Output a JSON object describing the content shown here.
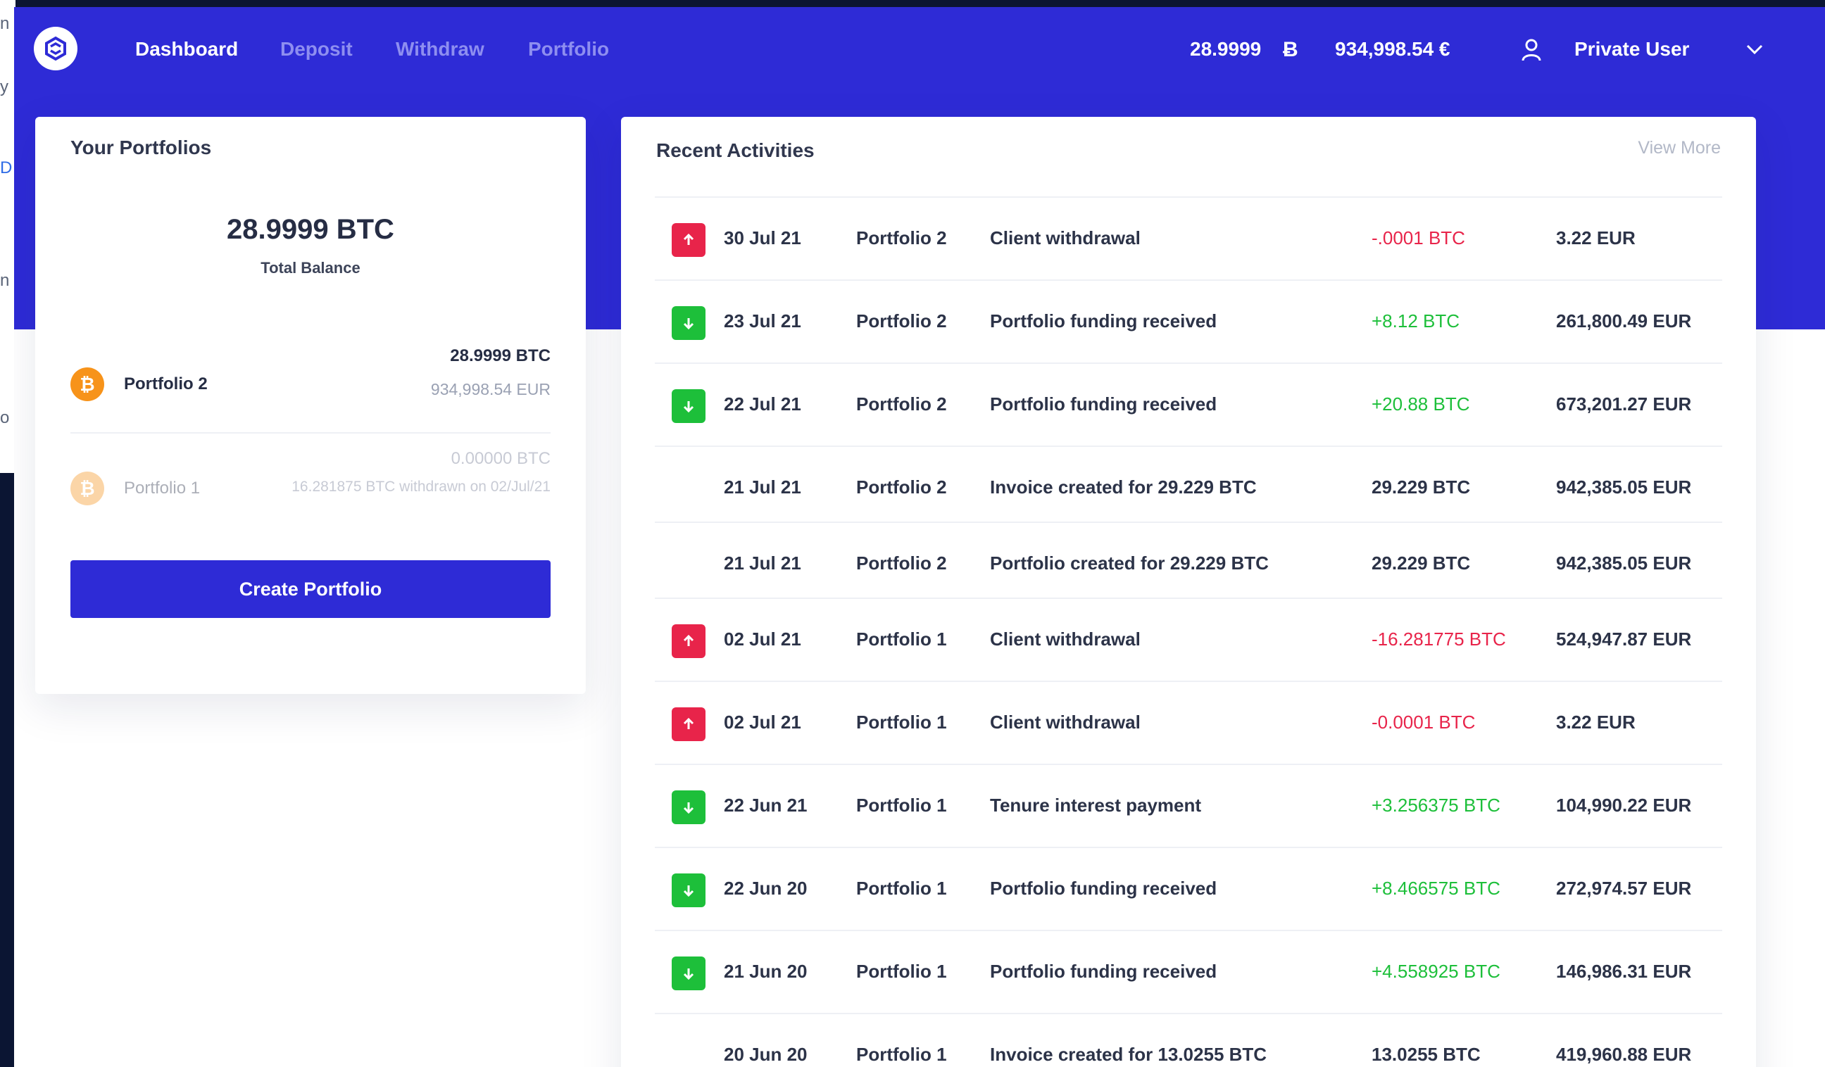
{
  "nav": {
    "items": [
      {
        "label": "Dashboard",
        "active": true
      },
      {
        "label": "Deposit",
        "active": false
      },
      {
        "label": "Withdraw",
        "active": false
      },
      {
        "label": "Portfolio",
        "active": false
      }
    ],
    "btc_balance": "28.9999",
    "btc_symbol": "Ƀ",
    "eur_balance": "934,998.54 €",
    "user_name": "Private User"
  },
  "colors": {
    "brand": "#2e2bd6",
    "negative": "#e8244a",
    "positive": "#1dbf3a",
    "bitcoin": "#f7931a"
  },
  "portfolios": {
    "title": "Your Portfolios",
    "total_balance": "28.9999 BTC",
    "total_label": "Total Balance",
    "items": [
      {
        "name": "Portfolio 2",
        "btc": "28.9999 BTC",
        "eur": "934,998.54 EUR",
        "active": true
      },
      {
        "name": "Portfolio 1",
        "btc": "0.00000 BTC",
        "eur": "16.281875 BTC withdrawn on 02/Jul/21",
        "active": false
      }
    ],
    "create_label": "Create Portfolio"
  },
  "activities": {
    "title": "Recent Activities",
    "view_more": "View More",
    "rows": [
      {
        "type": "out",
        "date": "30 Jul 21",
        "portfolio": "Portfolio 2",
        "desc": "Client withdrawal",
        "amount": "-.0001 BTC",
        "eur": "3.22 EUR"
      },
      {
        "type": "in",
        "date": "23 Jul 21",
        "portfolio": "Portfolio 2",
        "desc": "Portfolio funding received",
        "amount": "+8.12 BTC",
        "eur": "261,800.49 EUR"
      },
      {
        "type": "in",
        "date": "22 Jul 21",
        "portfolio": "Portfolio 2",
        "desc": "Portfolio funding received",
        "amount": "+20.88 BTC",
        "eur": "673,201.27 EUR"
      },
      {
        "type": "none",
        "date": "21 Jul 21",
        "portfolio": "Portfolio 2",
        "desc": "Invoice created for 29.229 BTC",
        "amount": "29.229 BTC",
        "eur": "942,385.05 EUR"
      },
      {
        "type": "none",
        "date": "21 Jul 21",
        "portfolio": "Portfolio 2",
        "desc": "Portfolio created for 29.229 BTC",
        "amount": "29.229 BTC",
        "eur": "942,385.05 EUR"
      },
      {
        "type": "out",
        "date": "02 Jul 21",
        "portfolio": "Portfolio 1",
        "desc": "Client withdrawal",
        "amount": "-16.281775 BTC",
        "eur": "524,947.87 EUR"
      },
      {
        "type": "out",
        "date": "02 Jul 21",
        "portfolio": "Portfolio 1",
        "desc": "Client withdrawal",
        "amount": "-0.0001 BTC",
        "eur": "3.22 EUR"
      },
      {
        "type": "in",
        "date": "22 Jun 21",
        "portfolio": "Portfolio 1",
        "desc": "Tenure interest payment",
        "amount": "+3.256375 BTC",
        "eur": "104,990.22 EUR"
      },
      {
        "type": "in",
        "date": "22 Jun 20",
        "portfolio": "Portfolio 1",
        "desc": "Portfolio funding received",
        "amount": "+8.466575 BTC",
        "eur": "272,974.57 EUR"
      },
      {
        "type": "in",
        "date": "21 Jun 20",
        "portfolio": "Portfolio 1",
        "desc": "Portfolio funding received",
        "amount": "+4.558925 BTC",
        "eur": "146,986.31 EUR"
      },
      {
        "type": "none",
        "date": "20 Jun 20",
        "portfolio": "Portfolio 1",
        "desc": "Invoice created for 13.0255 BTC",
        "amount": "13.0255 BTC",
        "eur": "419,960.88 EUR"
      }
    ]
  }
}
